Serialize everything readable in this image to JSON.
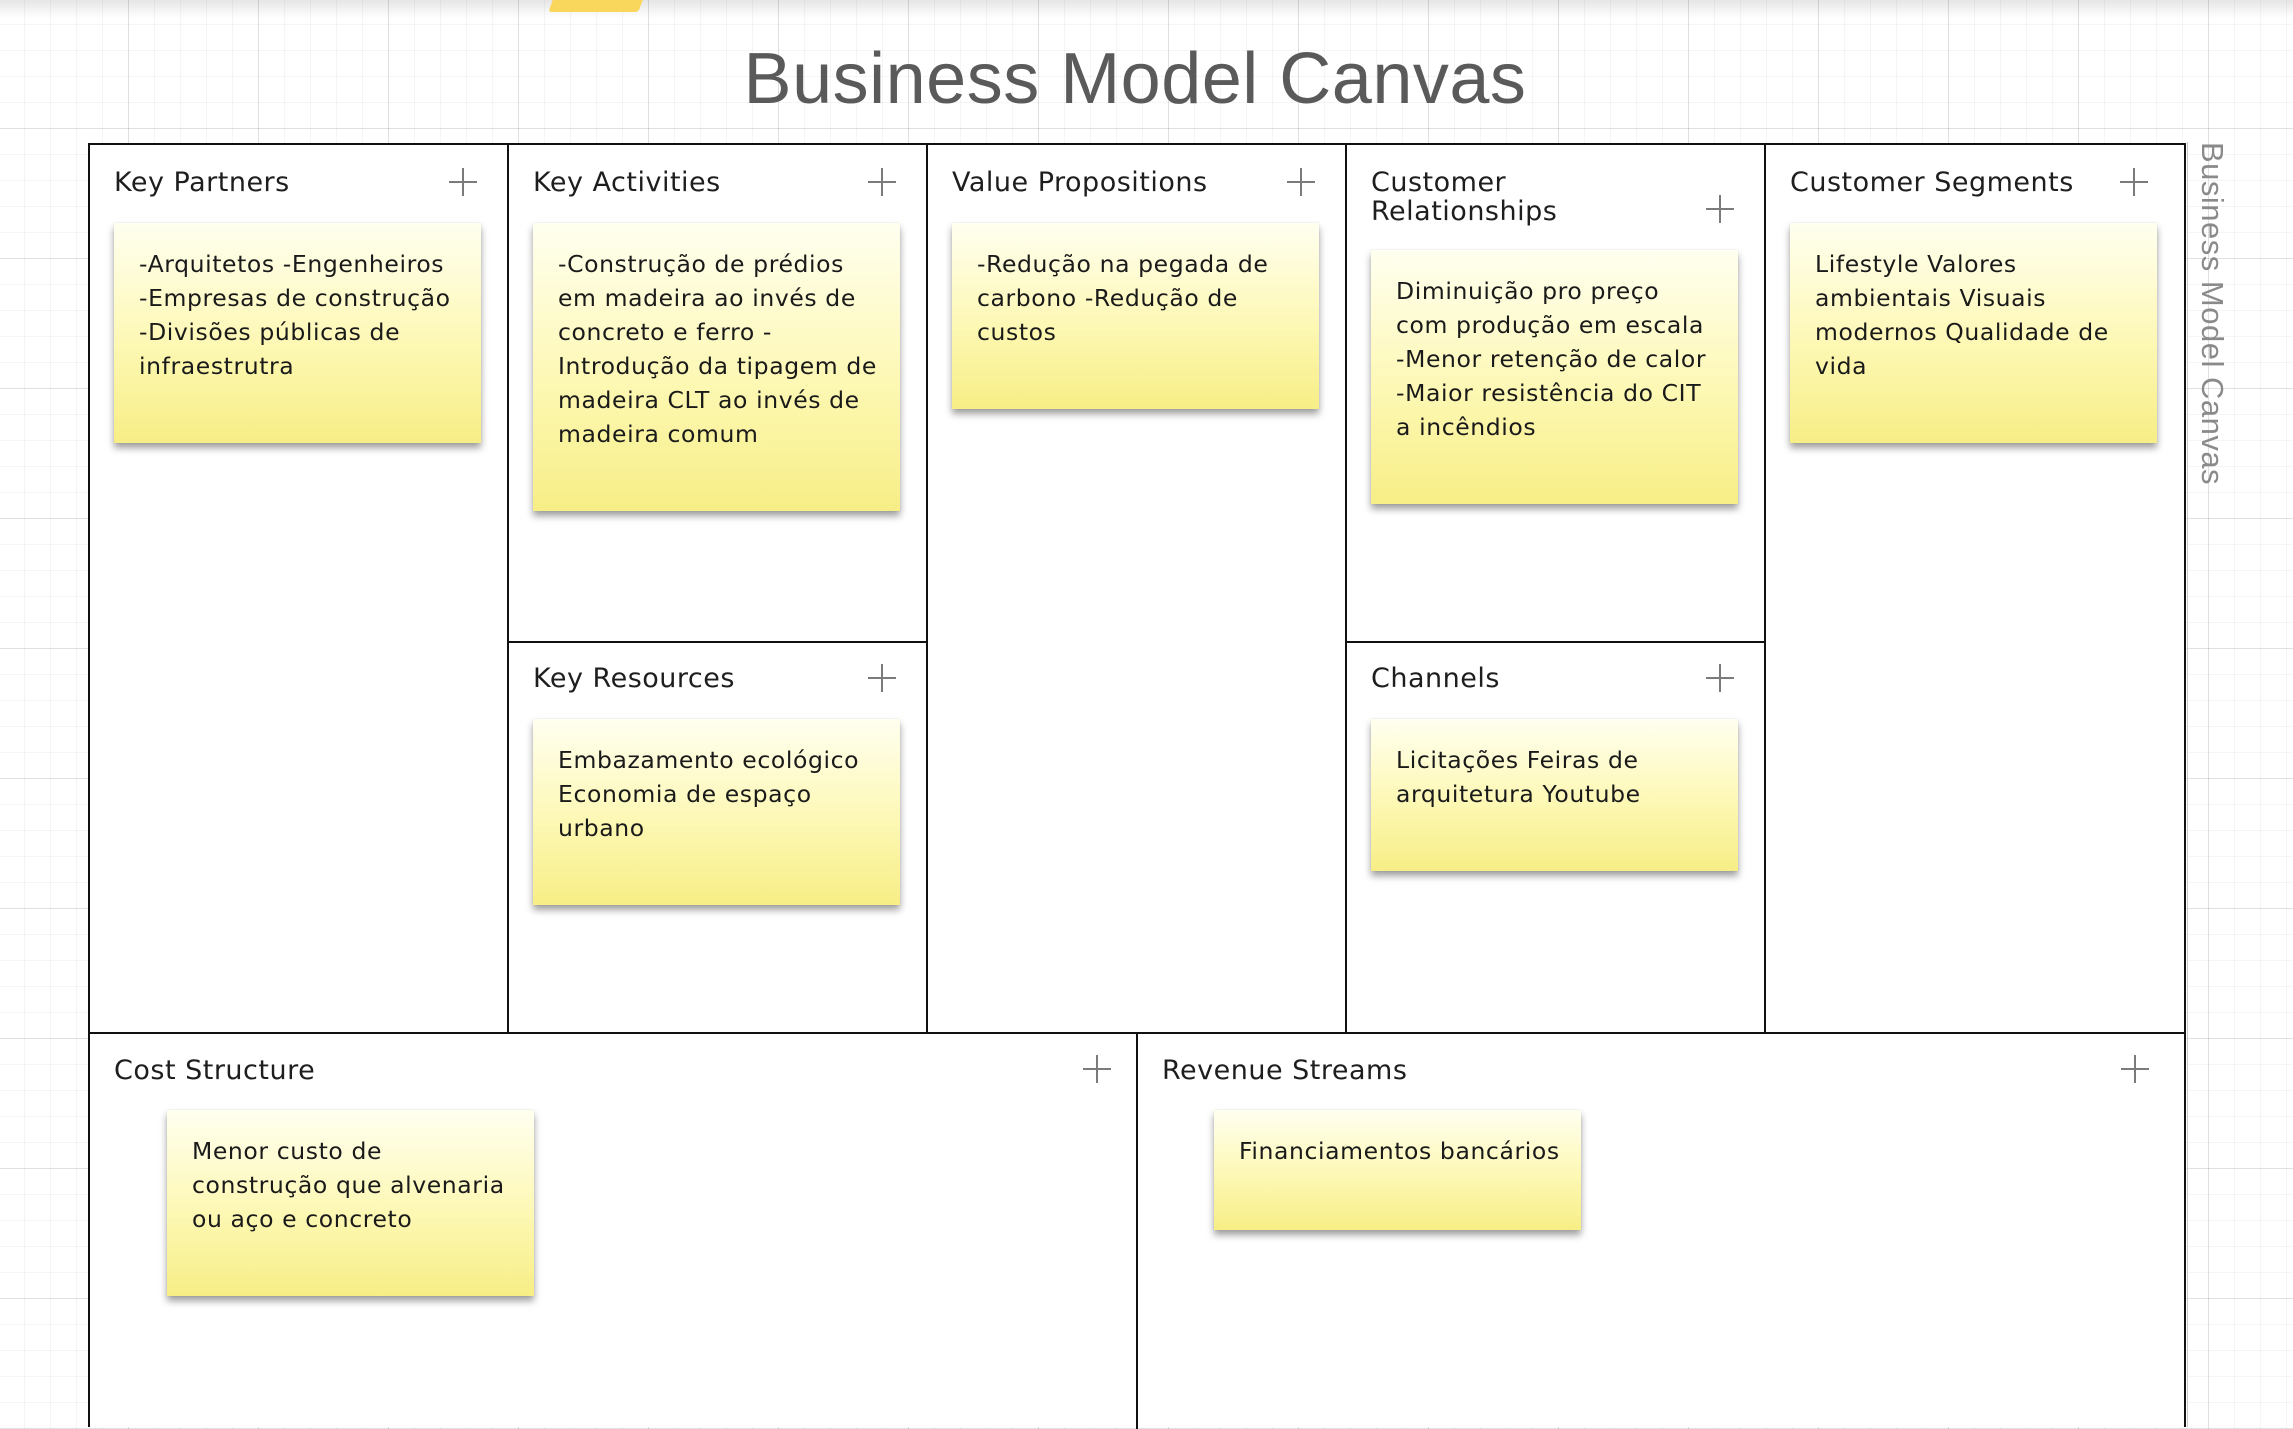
{
  "title": "Business Model Canvas",
  "side_title": "Business Model Canvas",
  "colors": {
    "note_yellow": "#fdf8b4",
    "border": "#111111",
    "grid": "#e0e0e0"
  },
  "sections": {
    "key_partners": {
      "title": "Key Partners",
      "notes": [
        "-Arquitetos -Engenheiros -Empresas de construção -Divisões públicas de infraestrutra"
      ]
    },
    "key_activities": {
      "title": "Key Activities",
      "notes": [
        "-Construção de prédios em madeira ao invés de concreto e ferro -Introdução da tipagem de madeira CLT ao invés de madeira comum"
      ]
    },
    "key_resources": {
      "title": "Key Resources",
      "notes": [
        "Embazamento ecológico Economia de espaço urbano"
      ]
    },
    "value_propositions": {
      "title": "Value Propositions",
      "notes": [
        "-Redução na pegada de carbono -Redução de custos"
      ]
    },
    "customer_relationships": {
      "title": "Customer Relationships",
      "notes": [
        "Diminuição pro preço com produção em escala -Menor retenção de calor -Maior resistência do CIT a incêndios"
      ]
    },
    "channels": {
      "title": "Channels",
      "notes": [
        "Licitações Feiras de arquitetura Youtube"
      ]
    },
    "customer_segments": {
      "title": "Customer Segments",
      "notes": [
        "Lifestyle Valores ambientais Visuais modernos Qualidade de vida"
      ]
    },
    "cost_structure": {
      "title": "Cost Structure",
      "notes": [
        "Menor custo de construção que alvenaria ou aço e concreto"
      ]
    },
    "revenue_streams": {
      "title": "Revenue Streams",
      "notes": [
        "Financiamentos bancários"
      ]
    }
  }
}
